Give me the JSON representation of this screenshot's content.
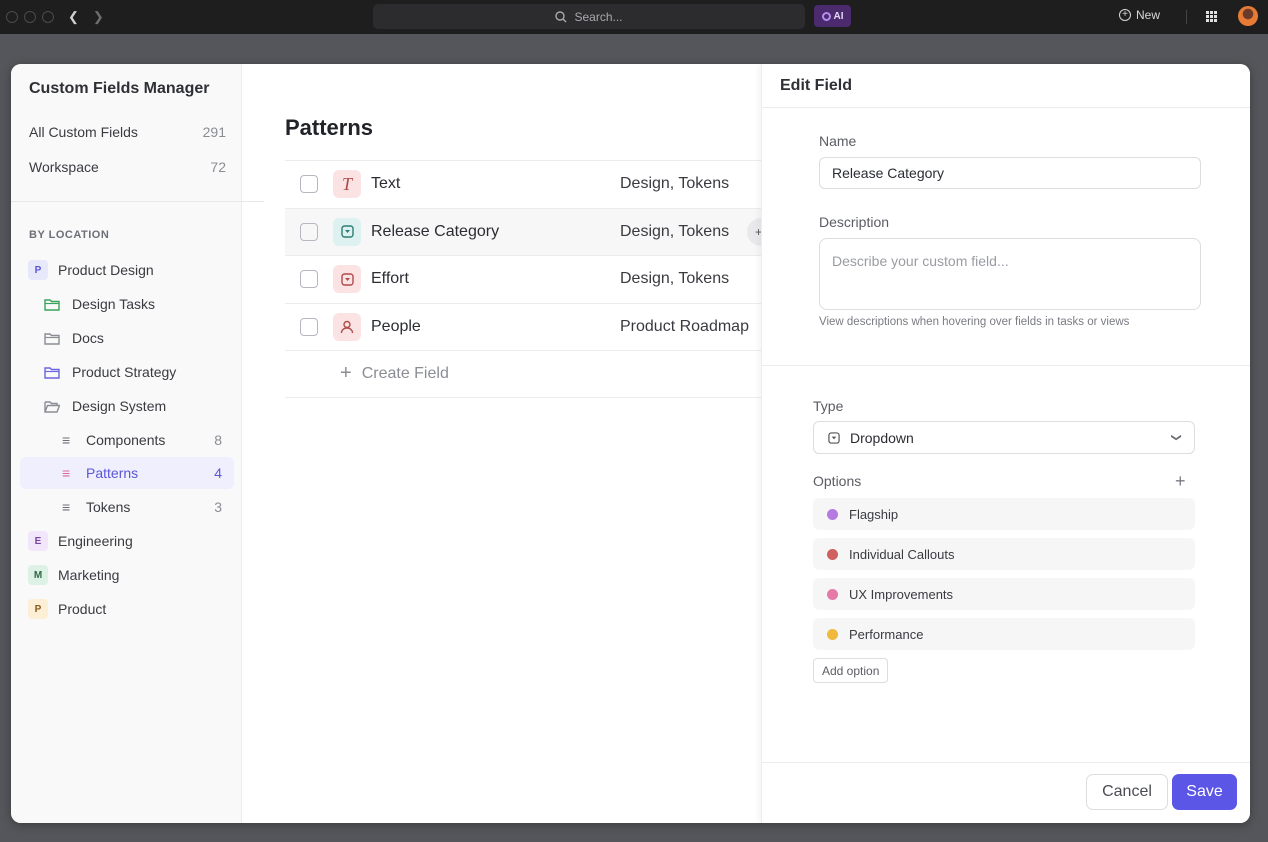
{
  "topbar": {
    "search_placeholder": "Search...",
    "ai_label": "AI",
    "new_label": "New"
  },
  "sidebar": {
    "title": "Custom Fields Manager",
    "summary": [
      {
        "label": "All Custom Fields",
        "count": "291"
      },
      {
        "label": "Workspace",
        "count": "72"
      }
    ],
    "section_label": "BY LOCATION",
    "locations": [
      {
        "kind": "space",
        "badge": "P",
        "label": "Product Design",
        "badge_bg": "#e8e8fb",
        "badge_fg": "#5b56d8"
      },
      {
        "kind": "folder",
        "label": "Design Tasks",
        "color": "#3aa35b"
      },
      {
        "kind": "folder",
        "label": "Docs",
        "color": "#8b8d94"
      },
      {
        "kind": "folder",
        "label": "Product Strategy",
        "color": "#6c66e0"
      },
      {
        "kind": "folder-open",
        "label": "Design System",
        "color": "#8b8d94"
      },
      {
        "kind": "list",
        "label": "Components",
        "count": "8"
      },
      {
        "kind": "list",
        "label": "Patterns",
        "count": "4",
        "active": true
      },
      {
        "kind": "list",
        "label": "Tokens",
        "count": "3"
      },
      {
        "kind": "space",
        "badge": "E",
        "label": "Engineering",
        "badge_bg": "#f1e6fa",
        "badge_fg": "#7a4a9a"
      },
      {
        "kind": "space",
        "badge": "M",
        "label": "Marketing",
        "badge_bg": "#ddf1e4",
        "badge_fg": "#2e6a45"
      },
      {
        "kind": "space",
        "badge": "P",
        "label": "Product",
        "badge_bg": "#fcefd6",
        "badge_fg": "#8a5a1a"
      }
    ]
  },
  "main": {
    "title": "Patterns",
    "fields": [
      {
        "name": "Text",
        "type_icon": "text-icon",
        "location": "Design, Tokens",
        "icon_bg": "#fbe3e3",
        "icon_fg": "#b14a4a"
      },
      {
        "name": "Release Category",
        "type_icon": "dropdown-icon",
        "location": "Design, Tokens",
        "icon_bg": "#ddf1f0",
        "icon_fg": "#2e7d74",
        "hovered": true
      },
      {
        "name": "Effort",
        "type_icon": "dropdown-icon",
        "location": "Design, Tokens",
        "icon_bg": "#fbe3e3",
        "icon_fg": "#b14a4a"
      },
      {
        "name": "People",
        "type_icon": "person-icon",
        "location": "Product Roadmap",
        "icon_bg": "#fbe3e3",
        "icon_fg": "#b14a4a"
      }
    ],
    "create_label": "Create Field"
  },
  "edit_panel": {
    "title": "Edit Field",
    "name_label": "Name",
    "name_value": "Release Category",
    "description_label": "Description",
    "description_placeholder": "Describe your custom field...",
    "description_hint": "View descriptions when hovering over fields in tasks or views",
    "type_label": "Type",
    "type_value": "Dropdown",
    "options_label": "Options",
    "options": [
      {
        "label": "Flagship",
        "color": "#b57be0"
      },
      {
        "label": "Individual Callouts",
        "color": "#d05f5f"
      },
      {
        "label": "UX Improvements",
        "color": "#e57aa8"
      },
      {
        "label": "Performance",
        "color": "#f0b93d"
      }
    ],
    "add_option_label": "Add option",
    "cancel_label": "Cancel",
    "save_label": "Save"
  }
}
